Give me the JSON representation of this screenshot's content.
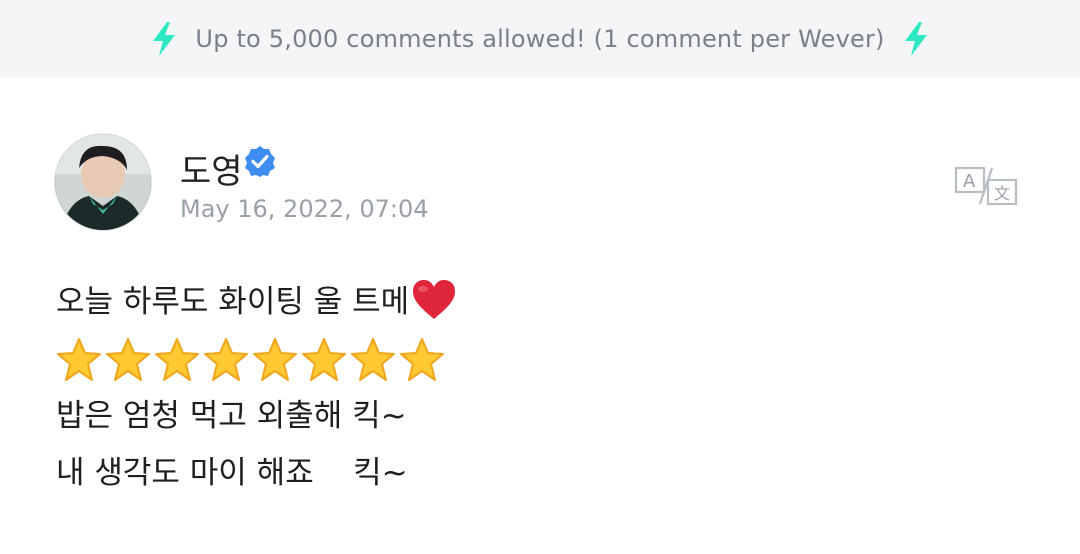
{
  "banner": {
    "text": "Up to 5,000 comments allowed! (1 comment per Wever)",
    "accent_color": "#2ee8c4",
    "icon": "lightning-bolt-icon"
  },
  "post": {
    "author": "도영",
    "verified": true,
    "timestamp": "May 16, 2022, 07:04",
    "translate_icon": "translate-icon",
    "lines": [
      "오늘 하루도 화이팅 울 트메",
      "밥은 엄청 먹고 외출해 킥~",
      "내 생각도 마이 해죠    킥~"
    ],
    "heart_emoji": "❤️",
    "star_emoji": "⭐",
    "star_count": 8
  }
}
